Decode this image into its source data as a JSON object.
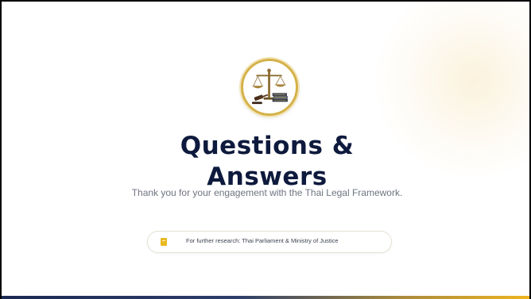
{
  "slide": {
    "title_line1": "Questions &",
    "title_line2": "Answers",
    "subtitle": "Thank you for your engagement with the Thai Legal Framework.",
    "research_note": "For further research: Thai Parliament & Ministry of Justice",
    "emblem_icon": "scales-of-justice-icon",
    "note_icon": "book-icon"
  },
  "colors": {
    "title": "#0e1a3d",
    "accent_gold": "#e8b923",
    "subtitle": "#6f7480",
    "bottom_bar_start": "#1b2a52",
    "bottom_bar_end": "#f0b520"
  }
}
